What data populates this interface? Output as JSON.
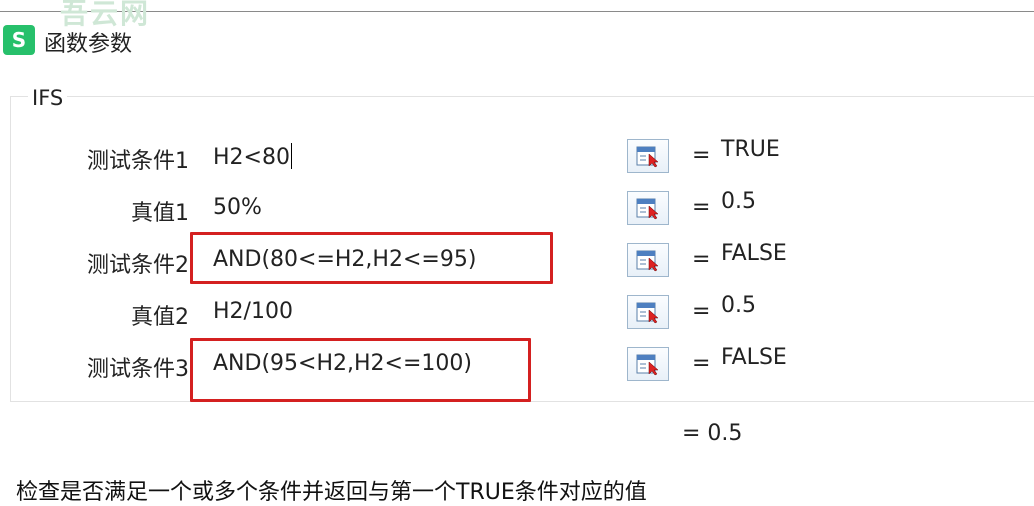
{
  "watermark": "吾云网",
  "dialog": {
    "app_icon_letter": "S",
    "title": "函数参数"
  },
  "function_group": {
    "name": "IFS",
    "rows": [
      {
        "label": "测试条件1",
        "input": "H2<80",
        "value": "TRUE"
      },
      {
        "label": "真值1",
        "input": "50%",
        "value": "0.5"
      },
      {
        "label": "测试条件2",
        "input": "AND(80<=H2,H2<=95)",
        "value": "FALSE"
      },
      {
        "label": "真值2",
        "input": "H2/100",
        "value": "0.5"
      },
      {
        "label": "测试条件3",
        "input": "AND(95<H2,H2<=100)",
        "value": "FALSE"
      }
    ],
    "equals_sign": "="
  },
  "result": "= 0.5",
  "description": "检查是否满足一个或多个条件并返回与第一个TRUE条件对应的值",
  "colors": {
    "highlight": "#d42020",
    "app_icon": "#27c06b"
  },
  "icons": {
    "ref_button": "collapse-dialog-icon"
  }
}
